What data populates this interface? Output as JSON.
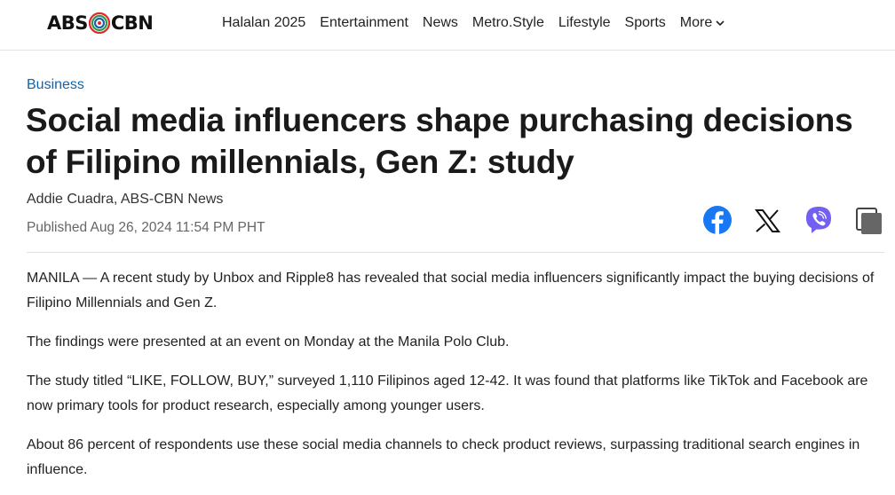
{
  "header": {
    "logo": {
      "left": "ABS",
      "right": "CBN"
    },
    "nav": [
      "Halalan 2025",
      "Entertainment",
      "News",
      "Metro.Style",
      "Lifestyle",
      "Sports"
    ],
    "more_label": "More"
  },
  "article": {
    "category": "Business",
    "headline": "Social media influencers shape purchasing decisions of Filipino millennials, Gen Z: study",
    "author": "Addie Cuadra, ABS-CBN News",
    "published": "Published Aug 26, 2024 11:54 PM PHT",
    "paragraphs": [
      "MANILA — A recent study by Unbox and Ripple8 has revealed that social media influencers significantly impact the buying decisions of Filipino Millennials and Gen Z.",
      "The findings were presented at an event on Monday at the Manila Polo Club.",
      "The study titled “LIKE, FOLLOW, BUY,” surveyed 1,110 Filipinos aged 12-42. It was found that platforms like TikTok and Facebook are now primary tools for product research, especially among younger users.",
      "About 86 percent of respondents use these social media channels to check product reviews, surpassing traditional search engines in influence."
    ]
  },
  "share": {
    "icons": [
      "facebook-icon",
      "x-icon",
      "viber-icon",
      "copy-link-icon"
    ]
  },
  "colors": {
    "category": "#1463a7",
    "facebook": "#1877f2",
    "viber": "#7360f2"
  }
}
